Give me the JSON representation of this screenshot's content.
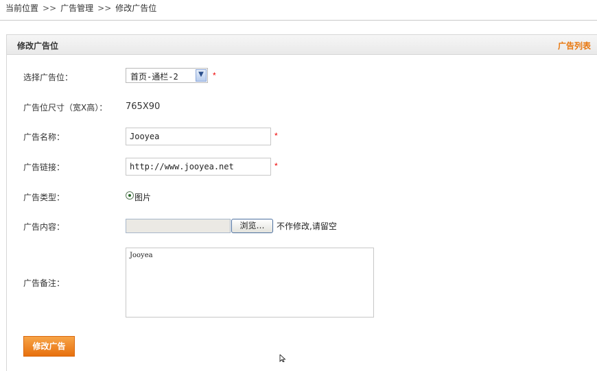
{
  "breadcrumb": {
    "items": [
      "当前位置",
      "广告管理",
      "修改广告位"
    ],
    "separator": ">>"
  },
  "panel": {
    "title": "修改广告位",
    "link_label": "广告列表",
    "accent_color": "#e8770e"
  },
  "form": {
    "position": {
      "label": "选择广告位：",
      "value": "首页-通栏-2"
    },
    "size": {
      "label": "广告位尺寸（宽X高）：",
      "value": "765X90"
    },
    "name": {
      "label": "广告名称：",
      "value": "Jooyea"
    },
    "url": {
      "label": "广告链接：",
      "value": "http://www.jooyea.net"
    },
    "type": {
      "label": "广告类型：",
      "option": "图片",
      "checked": true
    },
    "content": {
      "label": "广告内容：",
      "browse_label": "浏览…",
      "hint": "不作修改,请留空"
    },
    "note": {
      "label": "广告备注：",
      "value": "Jooyea"
    },
    "required_mark": "*"
  },
  "submit": {
    "label": "修改广告",
    "color": "#f08a24"
  }
}
